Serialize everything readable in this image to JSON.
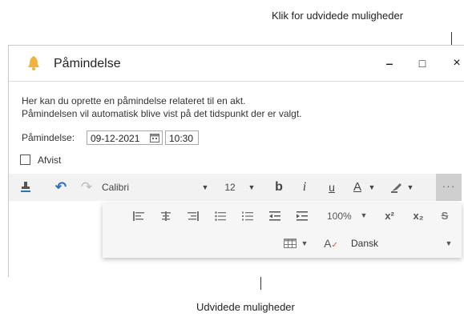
{
  "callouts": {
    "top": "Klik for udvidede muligheder",
    "bottom": "Udvidede muligheder"
  },
  "window": {
    "title": "Påmindelse",
    "minimize": "‒",
    "maximize": "□",
    "close": "×"
  },
  "body": {
    "line1": "Her kan du oprette en påmindelse relateret til en akt.",
    "line2": "Påmindelsen vil automatisk blive vist på det tidspunkt der er valgt.",
    "reminder_label": "Påmindelse:",
    "date_value": "09-12-2021",
    "time_value": "10:30",
    "dismissed_label": "Afvist",
    "dismissed_checked": false
  },
  "toolbar": {
    "font_name": "Calibri",
    "font_size": "12",
    "bold": "b",
    "italic": "i",
    "underline": "u",
    "font_color": "A",
    "more": "···"
  },
  "extended": {
    "zoom": "100%",
    "superscript": "x²",
    "subscript": "x₂",
    "strike": "S",
    "language": "Dansk"
  },
  "colors": {
    "bell": "#f2b33d",
    "undo": "#2f6fc0",
    "more_bg": "#cfcfcf",
    "spell_red": "#e05050"
  }
}
